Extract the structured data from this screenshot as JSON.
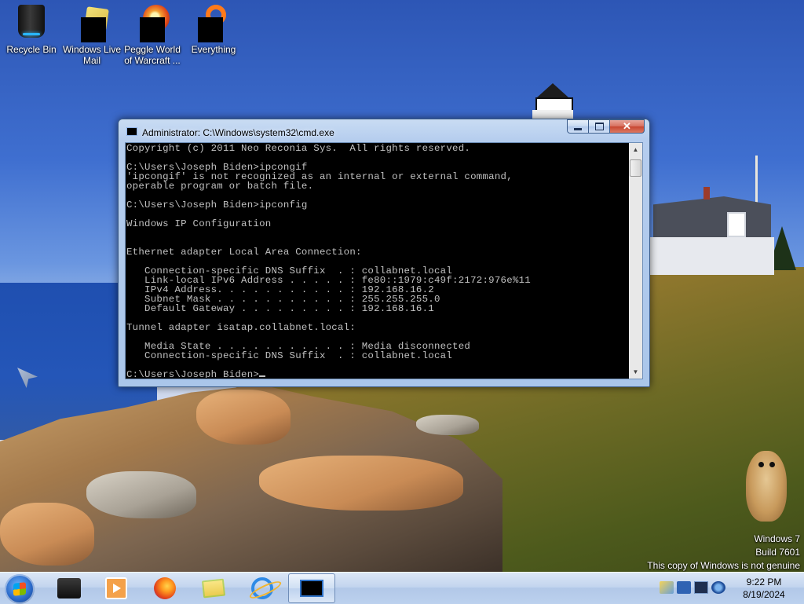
{
  "desktop": {
    "icons": [
      {
        "label": "Recycle Bin",
        "icon": "recycle-bin-icon"
      },
      {
        "label": "Windows Live Mail",
        "icon": "windows-live-mail-icon"
      },
      {
        "label": "Peggle World of Warcraft ...",
        "icon": "peggle-icon"
      },
      {
        "label": "Everything",
        "icon": "everything-icon"
      }
    ]
  },
  "window": {
    "title": "Administrator: C:\\Windows\\system32\\cmd.exe",
    "console_lines": [
      "Copyright (c) 2011 Neo Reconia Sys.  All rights reserved.",
      "",
      "C:\\Users\\Joseph Biden>ipcongif",
      "'ipcongif' is not recognized as an internal or external command,",
      "operable program or batch file.",
      "",
      "C:\\Users\\Joseph Biden>ipconfig",
      "",
      "Windows IP Configuration",
      "",
      "",
      "Ethernet adapter Local Area Connection:",
      "",
      "   Connection-specific DNS Suffix  . : collabnet.local",
      "   Link-local IPv6 Address . . . . . : fe80::1979:c49f:2172:976e%11",
      "   IPv4 Address. . . . . . . . . . . : 192.168.16.2",
      "   Subnet Mask . . . . . . . . . . . : 255.255.255.0",
      "   Default Gateway . . . . . . . . . : 192.168.16.1",
      "",
      "Tunnel adapter isatap.collabnet.local:",
      "",
      "   Media State . . . . . . . . . . . : Media disconnected",
      "   Connection-specific DNS Suffix  . : collabnet.local",
      ""
    ],
    "prompt": "C:\\Users\\Joseph Biden>"
  },
  "watermark": {
    "line1": "Windows 7",
    "line2": "Build 7601",
    "line3": "This copy of Windows is not genuine"
  },
  "taskbar": {
    "pinned": [
      "start-orb-icon",
      "computer-case-icon",
      "media-player-icon",
      "firefox-icon",
      "explorer-folder-icon",
      "internet-explorer-icon",
      "cmd-icon"
    ],
    "clock_time": "9:22 PM",
    "clock_date": "8/19/2024"
  },
  "colors": {
    "console_bg": "#000000",
    "console_fg": "#c0c0c0",
    "close_button": "#c74530"
  }
}
